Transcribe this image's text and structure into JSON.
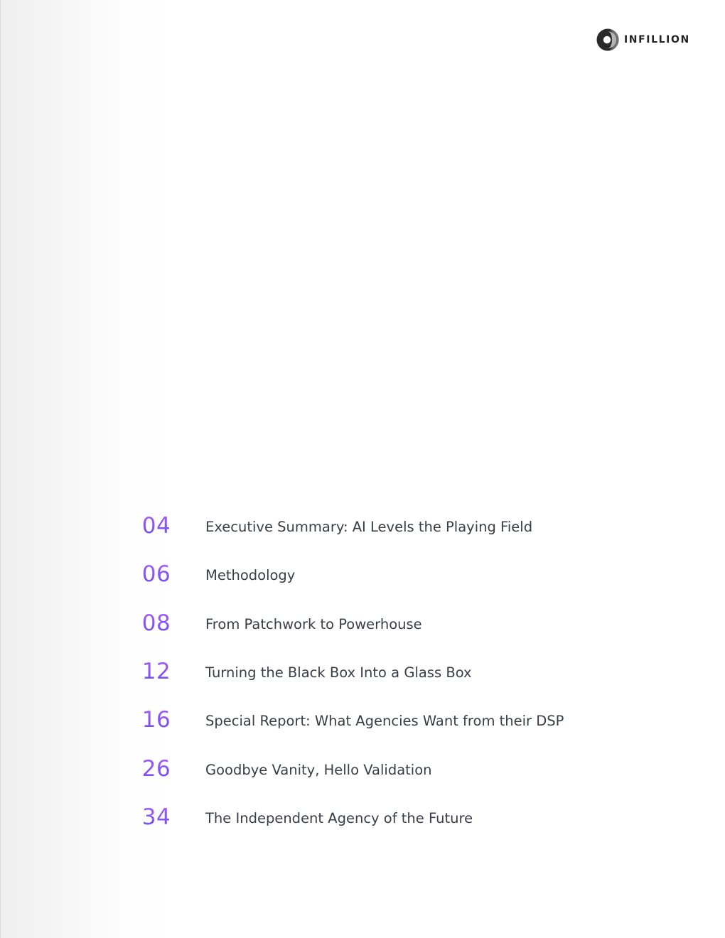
{
  "brand": {
    "name": "INFILLION",
    "logo_icon": "infillion-circle-logo-icon",
    "accent_color": "#8a3ffc",
    "text_color": "#3a3d47"
  },
  "toc": {
    "items": [
      {
        "page": "04",
        "title": "Executive Summary: AI Levels the Playing Field"
      },
      {
        "page": "06",
        "title": "Methodology"
      },
      {
        "page": "08",
        "title": "From Patchwork to Powerhouse"
      },
      {
        "page": "12",
        "title": "Turning the Black Box Into a Glass Box"
      },
      {
        "page": "16",
        "title": "Special Report: What Agencies Want from their DSP"
      },
      {
        "page": "26",
        "title": "Goodbye Vanity, Hello Validation"
      },
      {
        "page": "34",
        "title": "The Independent Agency of the Future"
      }
    ]
  }
}
